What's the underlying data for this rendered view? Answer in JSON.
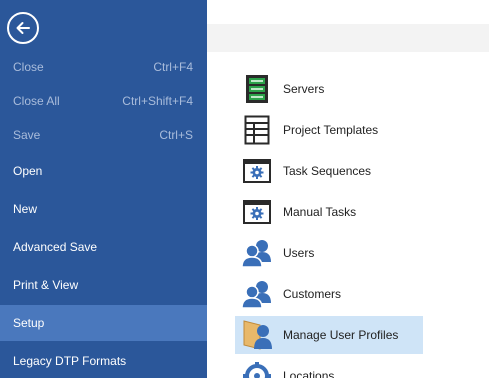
{
  "sidebar": {
    "items": [
      {
        "label": "Close",
        "shortcut": "Ctrl+F4",
        "state": "disabled"
      },
      {
        "label": "Close All",
        "shortcut": "Ctrl+Shift+F4",
        "state": "disabled"
      },
      {
        "label": "Save",
        "shortcut": "Ctrl+S",
        "state": "disabled"
      },
      {
        "label": "Open",
        "shortcut": "",
        "state": "normal"
      },
      {
        "label": "New",
        "shortcut": "",
        "state": "normal"
      },
      {
        "label": "Advanced Save",
        "shortcut": "",
        "state": "normal"
      },
      {
        "label": "Print & View",
        "shortcut": "",
        "state": "normal"
      },
      {
        "label": "Setup",
        "shortcut": "",
        "state": "active"
      },
      {
        "label": "Legacy DTP Formats",
        "shortcut": "",
        "state": "normal"
      }
    ]
  },
  "content": {
    "items": [
      {
        "label": "Servers",
        "icon": "server-icon"
      },
      {
        "label": "Project Templates",
        "icon": "template-icon"
      },
      {
        "label": "Task Sequences",
        "icon": "task-sequence-icon"
      },
      {
        "label": "Manual Tasks",
        "icon": "manual-task-icon"
      },
      {
        "label": "Users",
        "icon": "users-icon"
      },
      {
        "label": "Customers",
        "icon": "customers-icon"
      },
      {
        "label": "Manage User Profiles",
        "icon": "user-profile-icon"
      },
      {
        "label": "Locations",
        "icon": "location-icon"
      }
    ]
  },
  "colors": {
    "sidebar_bg": "#2b579a",
    "sidebar_active": "#4a78bd",
    "disabled_text": "#a9bcdb",
    "selected_row": "#cfe4f7",
    "icon_blue": "#3a6fb8",
    "server_green": "#2ca24a"
  }
}
